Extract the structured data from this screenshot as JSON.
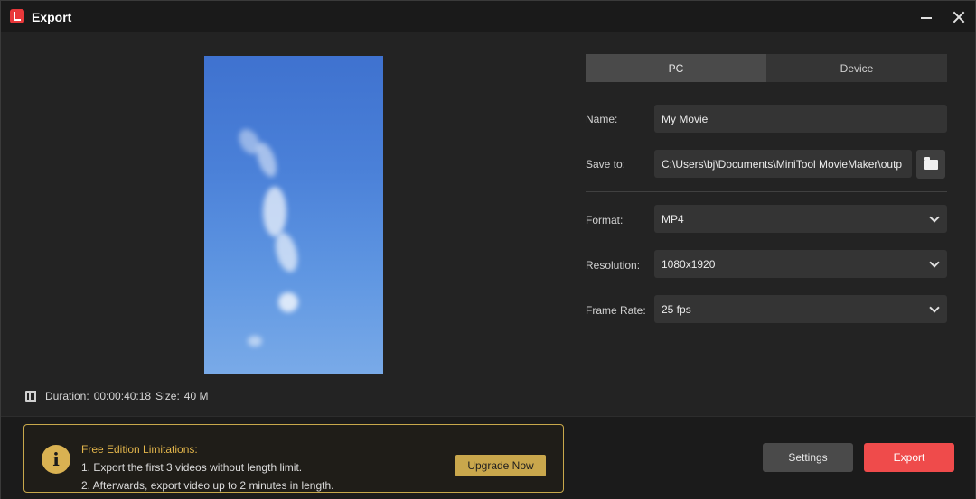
{
  "window": {
    "title": "Export"
  },
  "preview": {
    "duration_label": "Duration:",
    "duration": "00:00:40:18",
    "size_label": "Size:",
    "size": "40 M"
  },
  "tabs": [
    {
      "label": "PC",
      "active": true
    },
    {
      "label": "Device",
      "active": false
    }
  ],
  "form": {
    "name_label": "Name:",
    "name_value": "My Movie",
    "save_to_label": "Save to:",
    "save_to_value": "C:\\Users\\bj\\Documents\\MiniTool MovieMaker\\outp",
    "format_label": "Format:",
    "format_value": "MP4",
    "resolution_label": "Resolution:",
    "resolution_value": "1080x1920",
    "frame_rate_label": "Frame Rate:",
    "frame_rate_value": "25 fps"
  },
  "limitations": {
    "title": "Free Edition Limitations:",
    "line1": "1. Export the first 3 videos without length limit.",
    "line2": "2. Afterwards, export video up to 2 minutes in length.",
    "upgrade_label": "Upgrade Now"
  },
  "actions": {
    "settings_label": "Settings",
    "export_label": "Export"
  },
  "colors": {
    "accent_red": "#ef4b4b",
    "accent_gold": "#c9a74c",
    "background": "#232323"
  },
  "icons": [
    "app-logo-icon",
    "minimize-icon",
    "close-icon",
    "film-icon",
    "folder-icon",
    "chevron-down-icon",
    "info-icon"
  ]
}
